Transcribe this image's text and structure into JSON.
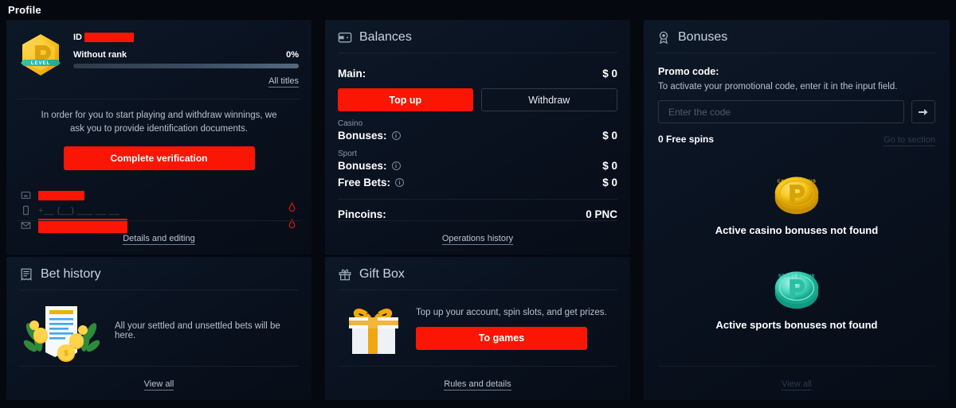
{
  "page": {
    "title": "Profile"
  },
  "profile": {
    "icon": "level-badge-icon",
    "badge_level_text": "LEVEL",
    "id_label": "ID",
    "id_value_redacted": "",
    "rank_label": "Without rank",
    "progress_percent": "0%",
    "progress_value": 0,
    "all_titles_link": "All titles",
    "verification_text": "In order for you to start playing and withdraw winnings, we ask you to provide identification documents.",
    "verification_button": "Complete verification",
    "contacts": [
      {
        "icon": "id-card-icon",
        "value": "",
        "redacted": true,
        "width": 58
      },
      {
        "icon": "phone-icon",
        "value": "+__ (__) ___ __ __",
        "redacted": false,
        "width": 0
      },
      {
        "icon": "envelope-icon",
        "value": "",
        "redacted": true,
        "width": 112
      }
    ],
    "warning_icons": [
      "warning-icon",
      "warning-icon"
    ],
    "footer_link": "Details and editing"
  },
  "balances": {
    "icon": "wallet-icon",
    "title": "Balances",
    "main": {
      "label": "Main:",
      "value": "$ 0"
    },
    "top_up_button": "Top up",
    "withdraw_button": "Withdraw",
    "casino_group": "Casino",
    "casino_bonuses": {
      "label": "Bonuses:",
      "value": "$ 0",
      "info": "i"
    },
    "sport_group": "Sport",
    "sport_bonuses": {
      "label": "Bonuses:",
      "value": "$ 0",
      "info": "i"
    },
    "free_bets": {
      "label": "Free Bets:",
      "value": "$ 0",
      "info": "i"
    },
    "pincoins": {
      "label": "Pincoins:",
      "value": "0 PNC"
    },
    "footer_link": "Operations history"
  },
  "bonuses": {
    "icon": "award-icon",
    "title": "Bonuses",
    "promo_title": "Promo code:",
    "promo_subtitle": "To activate your promotional code, enter it in the input field.",
    "promo_placeholder": "Enter the code",
    "promo_value": "",
    "submit_icon": "arrow-right-icon",
    "free_spins_count": "0",
    "free_spins_label": "Free spins",
    "go_to_section_link": "Go to section",
    "casino_empty": {
      "icon": "casino-bonus-coin-icon",
      "coin_text": "CASINO BONUS",
      "label": "Active casino bonuses not found"
    },
    "sport_empty": {
      "icon": "sport-bonus-coin-icon",
      "coin_text": "SPORT BONUS",
      "label": "Active sports bonuses not found"
    },
    "footer_link": "View all"
  },
  "bet_history": {
    "icon": "receipt-icon",
    "title": "Bet history",
    "illustration": "bet-slip-illustration",
    "description": "All your settled and unsettled bets will be here.",
    "footer_link": "View all"
  },
  "gift_box": {
    "icon": "gift-icon",
    "title": "Gift Box",
    "illustration": "gift-box-illustration",
    "description": "Top up your account, spin slots, and get prizes.",
    "button": "To games",
    "footer_link": "Rules and details"
  },
  "colors": {
    "background": "#05080f",
    "card": "#0b1320",
    "accent_red": "#fb1505",
    "text_primary": "#ffffff",
    "text_secondary": "#b6c2ce",
    "gold": "#f5c518",
    "teal": "#3fd6bd"
  }
}
